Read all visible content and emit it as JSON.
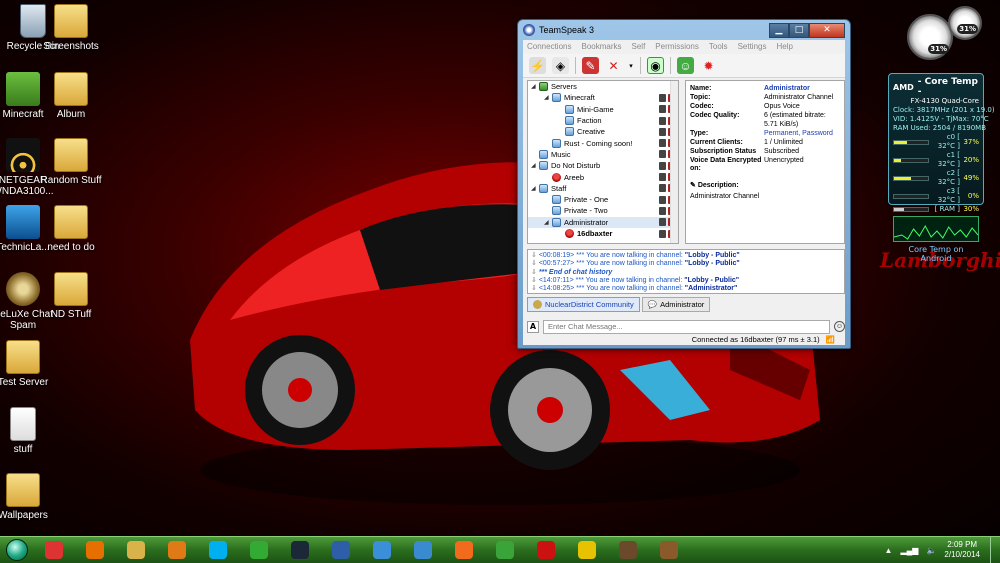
{
  "desktop": {
    "icons": [
      {
        "label": "Recycle Bin",
        "icon": "recycle-bin-icon"
      },
      {
        "label": "Screenshots",
        "icon": "folder-icon"
      },
      {
        "label": "Minecraft",
        "icon": "minecraft-icon"
      },
      {
        "label": "Album",
        "icon": "folder-icon"
      },
      {
        "label": "NETGEAR WNDA3100...",
        "icon": "netgear-icon"
      },
      {
        "label": "Random Stuff",
        "icon": "folder-icon"
      },
      {
        "label": "TechnicLa...",
        "icon": "technic-launcher-icon"
      },
      {
        "label": "need to do",
        "icon": "folder-icon"
      },
      {
        "label": "DeLuXe Chat Spam",
        "icon": "swirl-app-icon"
      },
      {
        "label": "ND STuff",
        "icon": "folder-icon"
      },
      {
        "label": "Test Server",
        "icon": "folder-icon"
      },
      {
        "label": "stuff",
        "icon": "document-icon"
      },
      {
        "label": "Wallpapers",
        "icon": "folder-icon"
      }
    ],
    "wallpaper_text": "Lamborghini"
  },
  "gauges": {
    "cpu_percent": "31%",
    "ram_percent": "31%"
  },
  "coretemp": {
    "title": "- Core Temp -",
    "brand": "AMD",
    "model": "FX-4130 Quad-Core",
    "clock": "Clock: 3817MHz (201 x 19.0)",
    "vid": "VID: 1.4125V - TjMax: 70°C",
    "ram": "RAM Used: 2504 / 8190MB",
    "cores": [
      {
        "label": "c0 [ 32°C ]",
        "load": "37%",
        "fill": 0.37
      },
      {
        "label": "c1 [ 32°C ]",
        "load": "20%",
        "fill": 0.2
      },
      {
        "label": "c2 [ 32°C ]",
        "load": "49%",
        "fill": 0.49
      },
      {
        "label": "c3 [ 32°C ]",
        "load": "0%",
        "fill": 0.0
      },
      {
        "label": "[ RAM ]",
        "load": "30%",
        "fill": 0.3
      }
    ],
    "footer": "Core Temp on Android"
  },
  "teamspeak": {
    "title": "TeamSpeak 3",
    "window_controls": {
      "minimize": "▁",
      "maximize": "□",
      "close": "✕"
    },
    "menu": [
      "Connections",
      "Bookmarks",
      "Self",
      "Permissions",
      "Tools",
      "Settings",
      "Help"
    ],
    "tree": [
      {
        "label": "Servers",
        "type": "channel",
        "indent": 0,
        "expanded": true
      },
      {
        "label": "Minecraft",
        "type": "channel",
        "indent": 1,
        "expanded": true
      },
      {
        "label": "Mini-Game",
        "type": "channel",
        "indent": 2
      },
      {
        "label": "Faction",
        "type": "channel",
        "indent": 2
      },
      {
        "label": "Creative",
        "type": "channel",
        "indent": 2
      },
      {
        "label": "Rust - Coming soon!",
        "type": "channel",
        "indent": 1
      },
      {
        "label": "Music",
        "type": "channel",
        "indent": 0
      },
      {
        "label": "Do Not Disturb",
        "type": "channel",
        "indent": 0,
        "expanded": true
      },
      {
        "label": "Areeb",
        "type": "user",
        "indent": 1
      },
      {
        "label": "Staff",
        "type": "channel",
        "indent": 0,
        "expanded": true
      },
      {
        "label": "Private - One",
        "type": "channel",
        "indent": 1
      },
      {
        "label": "Private - Two",
        "type": "channel",
        "indent": 1
      },
      {
        "label": "Administrator",
        "type": "channel",
        "indent": 1,
        "expanded": true,
        "selected": true
      },
      {
        "label": "16dbaxter",
        "type": "user",
        "indent": 2,
        "bold": true
      }
    ],
    "info": {
      "name_label": "Name:",
      "name": "Administrator",
      "topic_label": "Topic:",
      "topic": "Administrator Channel",
      "codec_label": "Codec:",
      "codec": "Opus Voice",
      "quality_label": "Codec Quality:",
      "quality": "6 (estimated bitrate: 5.71 KiB/s)",
      "type_label": "Type:",
      "type": "Permanent, Password",
      "clients_label": "Current Clients:",
      "clients": "1 / Unlimited",
      "sub_label": "Subscription Status",
      "sub": "Subscribed",
      "enc_label": "Voice Data Encrypted on:",
      "enc": "Unencrypted",
      "desc_label": "Description:",
      "desc": "Administrator Channel"
    },
    "chat_log": [
      {
        "time": "<00:08:19>",
        "text": "*** You are now talking in channel:",
        "channel": "\"Lobby - Public\""
      },
      {
        "time": "<00:57:27>",
        "text": "*** You are now talking in channel:",
        "channel": "\"Lobby - Public\""
      },
      {
        "time": "",
        "text": "*** End of chat history",
        "channel": ""
      },
      {
        "time": "<14:07:11>",
        "text": "*** You are now talking in channel:",
        "channel": "\"Lobby - Public\""
      },
      {
        "time": "<14:08:25>",
        "text": "*** You are now talking in channel:",
        "channel": "\"Administrator\""
      }
    ],
    "tabs": [
      "NuclearDistrict Community",
      "Administrator"
    ],
    "chat_placeholder": "Enter Chat Message...",
    "status": "Connected as 16dbaxter (97 ms ± 3.1)"
  },
  "taskbar": {
    "apps": [
      {
        "icon": "chrome-icon",
        "color": "#d33"
      },
      {
        "icon": "firefox-icon",
        "color": "#e76f00"
      },
      {
        "icon": "explorer-folder-icon",
        "color": "#d9b24a"
      },
      {
        "icon": "media-player-icon",
        "color": "#e07a16"
      },
      {
        "icon": "skype-icon",
        "color": "#00aff0"
      },
      {
        "icon": "razer-icon",
        "color": "#3a3"
      },
      {
        "icon": "steam-icon",
        "color": "#1b2838"
      },
      {
        "icon": "virtualbox-icon",
        "color": "#2f5ea8"
      },
      {
        "icon": "itunes-icon",
        "color": "#3a8fd8"
      },
      {
        "icon": "notepad-icon",
        "color": "#3a8ad0"
      },
      {
        "icon": "origin-icon",
        "color": "#f26a1b"
      },
      {
        "icon": "media-center-icon",
        "color": "#3aa33a"
      },
      {
        "icon": "filezilla-icon",
        "color": "#c11"
      },
      {
        "icon": "cheat-engine-icon",
        "color": "#e6c200"
      },
      {
        "icon": "minecraft-icon",
        "color": "#6a4a2a"
      },
      {
        "icon": "crafting-table-icon",
        "color": "#8b5a2b"
      }
    ],
    "clock_time": "2:09 PM",
    "clock_date": "2/10/2014"
  }
}
